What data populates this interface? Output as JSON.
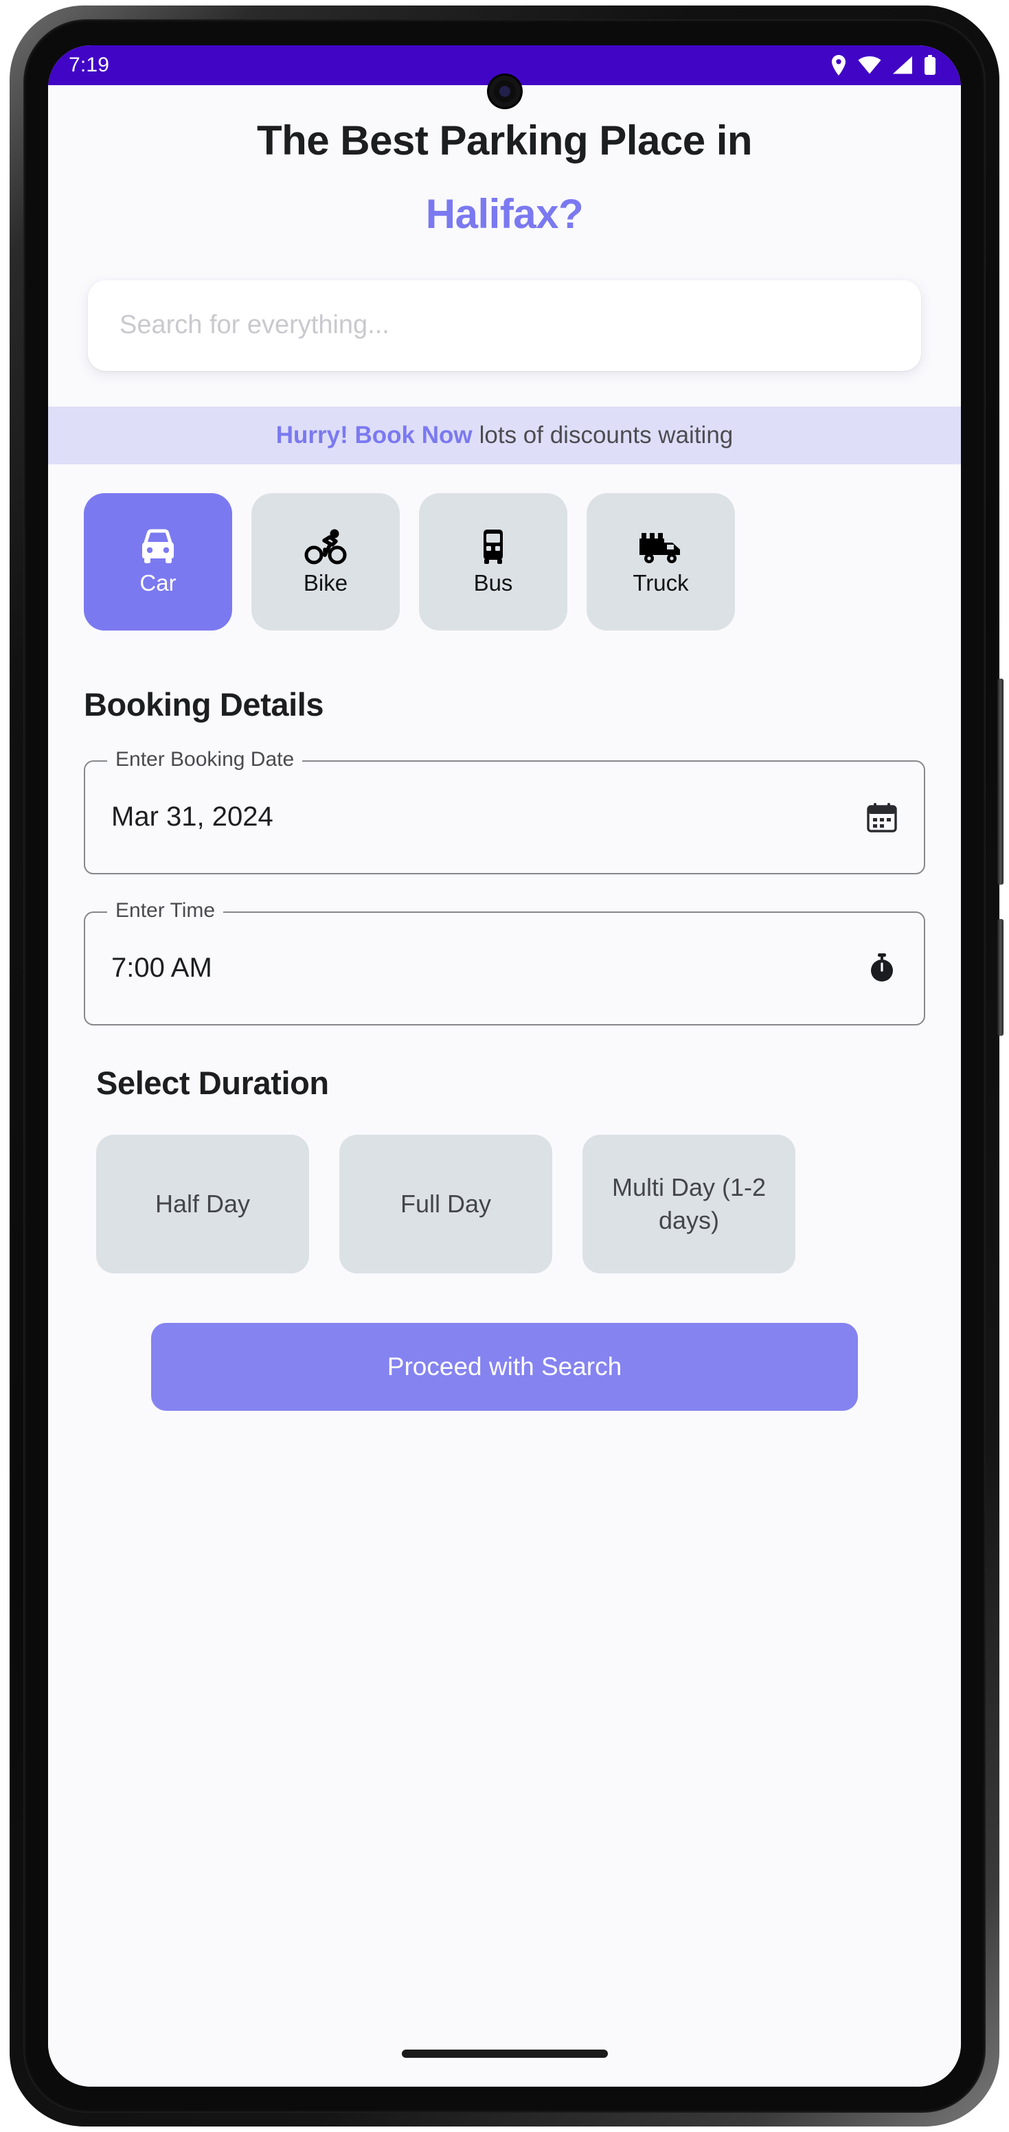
{
  "status_bar": {
    "time": "7:19",
    "background_color": "#4105C6",
    "icons": [
      "location-pin-icon",
      "wifi-icon",
      "cellular-signal-icon",
      "battery-icon"
    ]
  },
  "header": {
    "title_line1": "The Best Parking Place in",
    "title_line2": "Halifax?",
    "accent_color": "#7B79F0"
  },
  "search": {
    "placeholder": "Search for everything...",
    "value": ""
  },
  "promo": {
    "highlight": "Hurry! Book Now",
    "rest": "lots of discounts waiting",
    "background_color": "#DEDEF8",
    "highlight_color": "#7B79F0"
  },
  "vehicles": {
    "selected": "Car",
    "items": [
      {
        "label": "Car",
        "icon": "car-icon",
        "selected": true
      },
      {
        "label": "Bike",
        "icon": "bike-icon",
        "selected": false
      },
      {
        "label": "Bus",
        "icon": "bus-icon",
        "selected": false
      },
      {
        "label": "Truck",
        "icon": "truck-icon",
        "selected": false
      }
    ]
  },
  "booking": {
    "section_title": "Booking Details",
    "date_field": {
      "label": "Enter Booking Date",
      "value": "Mar 31, 2024",
      "icon": "calendar-icon"
    },
    "time_field": {
      "label": "Enter Time",
      "value": "7:00 AM",
      "icon": "timer-icon"
    }
  },
  "duration": {
    "section_title": "Select Duration",
    "options": [
      {
        "label": "Half Day",
        "selected": false
      },
      {
        "label": "Full Day",
        "selected": false
      },
      {
        "label": "Multi Day (1-2 days)",
        "selected": false
      }
    ]
  },
  "actions": {
    "proceed_label": "Proceed with Search",
    "proceed_color": "#8583F0"
  }
}
